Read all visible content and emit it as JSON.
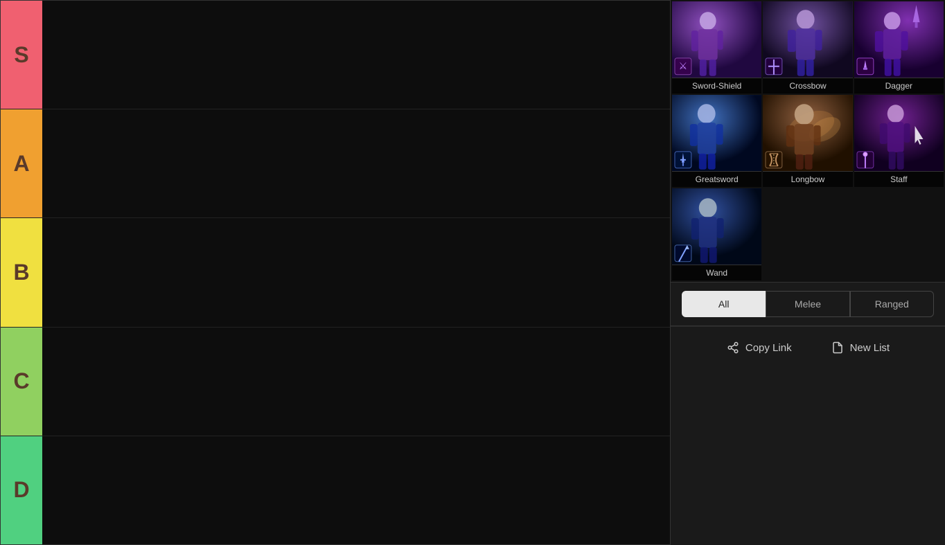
{
  "tiers": [
    {
      "id": "s",
      "label": "S",
      "color": "#f06070",
      "items": []
    },
    {
      "id": "a",
      "label": "A",
      "color": "#f0a030",
      "items": []
    },
    {
      "id": "b",
      "label": "B",
      "color": "#f0e040",
      "items": []
    },
    {
      "id": "c",
      "label": "C",
      "color": "#90d060",
      "items": []
    },
    {
      "id": "d",
      "label": "D",
      "color": "#50d080",
      "items": []
    }
  ],
  "weapons": [
    {
      "id": "sword-shield",
      "label": "Sword-Shield",
      "bgClass": "sword-shield-bg",
      "icon": "⚔"
    },
    {
      "id": "crossbow",
      "label": "Crossbow",
      "bgClass": "crossbow-bg",
      "icon": "╋"
    },
    {
      "id": "dagger",
      "label": "Dagger",
      "bgClass": "dagger-bg",
      "icon": "🗡"
    },
    {
      "id": "greatsword",
      "label": "Greatsword",
      "bgClass": "greatsword-bg",
      "icon": "⚔"
    },
    {
      "id": "longbow",
      "label": "Longbow",
      "bgClass": "longbow-bg",
      "icon": "🏹"
    },
    {
      "id": "staff",
      "label": "Staff",
      "bgClass": "staff-bg",
      "icon": "✦"
    },
    {
      "id": "wand",
      "label": "Wand",
      "bgClass": "wand-bg",
      "icon": "✦"
    }
  ],
  "filters": [
    {
      "id": "all",
      "label": "All",
      "active": true
    },
    {
      "id": "melee",
      "label": "Melee",
      "active": false
    },
    {
      "id": "ranged",
      "label": "Ranged",
      "active": false
    }
  ],
  "actions": {
    "copy_link": "Copy Link",
    "new_list": "New List"
  }
}
